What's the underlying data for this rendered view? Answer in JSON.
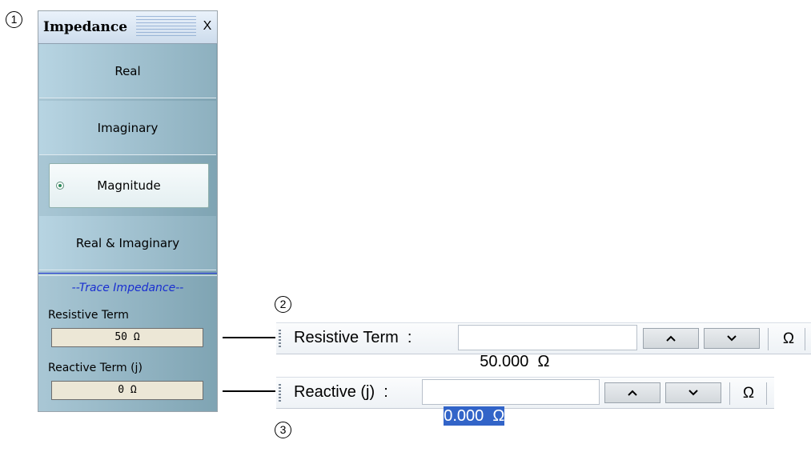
{
  "callouts": [
    "1",
    "2",
    "3"
  ],
  "panel": {
    "title": "Impedance",
    "close_label": "X",
    "menu_items": [
      {
        "label": "Real"
      },
      {
        "label": "Imaginary"
      },
      {
        "label": "Magnitude",
        "selected": true
      },
      {
        "label": "Real & Imaginary"
      }
    ],
    "section_header": "--Trace Impedance--",
    "resistive_label": "Resistive Term",
    "resistive_value": "50 Ω",
    "reactive_label": "Reactive Term (j)",
    "reactive_value": "0 Ω"
  },
  "resistive_toolbar": {
    "label": "Resistive Term  :",
    "value": "50.000  Ω",
    "up_icon": "chevron-up-icon",
    "down_icon": "chevron-down-icon",
    "unit_label": "Ω"
  },
  "reactive_toolbar": {
    "label": "Reactive (j)  :",
    "value": "0.000  Ω",
    "up_icon": "chevron-up-icon",
    "down_icon": "chevron-down-icon",
    "unit_label": "Ω"
  },
  "colors": {
    "accent_blue": "#1a2fd0",
    "selection": "#3264c8"
  }
}
